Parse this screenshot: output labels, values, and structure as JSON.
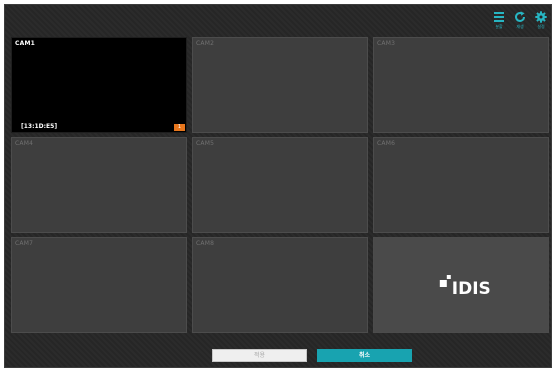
{
  "toolbar": {
    "items": [
      {
        "icon": "list-icon",
        "label": "분할"
      },
      {
        "icon": "refresh-icon",
        "label": "재생"
      },
      {
        "icon": "gear-icon",
        "label": "설정"
      }
    ]
  },
  "cameras": [
    {
      "label": "CAM1",
      "active": true,
      "time": "[13:1D:E5]",
      "badge": "1"
    },
    {
      "label": "CAM2"
    },
    {
      "label": "CAM3"
    },
    {
      "label": "CAM4"
    },
    {
      "label": "CAM5"
    },
    {
      "label": "CAM6"
    },
    {
      "label": "CAM7"
    },
    {
      "label": "CAM8"
    }
  ],
  "logo": {
    "text": "IDIS"
  },
  "footer": {
    "apply_label": "적용",
    "cancel_label": "취소"
  },
  "colors": {
    "accent": "#18a3b0",
    "badge": "#e8761c",
    "background": "#262626",
    "tile": "#3e3e3e"
  }
}
